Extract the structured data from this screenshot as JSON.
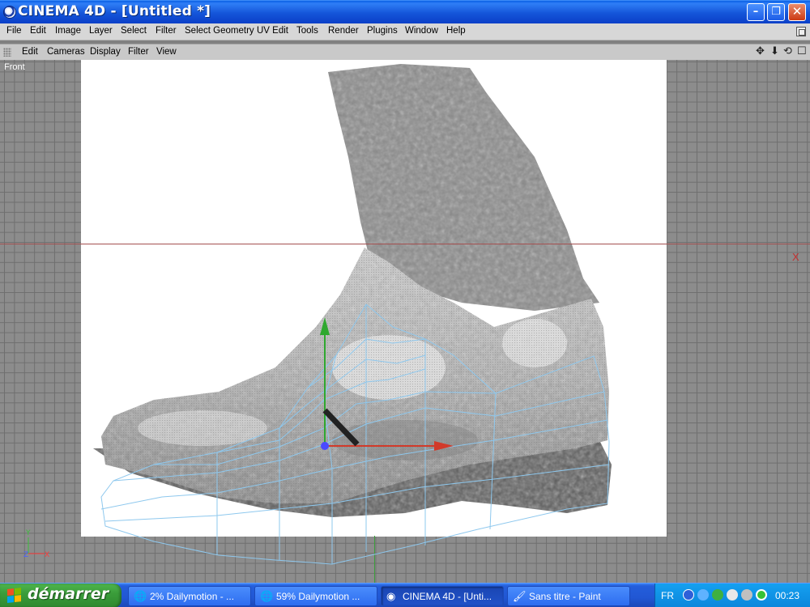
{
  "window": {
    "title": "CINEMA 4D - [Untitled *]",
    "min_glyph": "–",
    "max_glyph": "❐",
    "close_glyph": "✕"
  },
  "menubar": {
    "items": [
      "File",
      "Edit",
      "Image",
      "Layer",
      "Select",
      "Filter",
      "Select Geometry",
      "UV Edit",
      "Tools",
      "Render",
      "Plugins",
      "Window",
      "Help"
    ]
  },
  "viewport_menu": {
    "items": [
      "Edit",
      "Cameras",
      "Display",
      "Filter",
      "View"
    ],
    "nav_icons": [
      "move-icon",
      "down-arrow-icon",
      "rotate-icon",
      "maximize-icon"
    ]
  },
  "viewport": {
    "view_name": "Front",
    "axis_x_label": "X",
    "corner_axis": {
      "y": "Y",
      "z": "Z",
      "x": "X"
    }
  },
  "taskbar": {
    "start_label": "démarrer",
    "tasks": [
      {
        "label": "2% Dailymotion - ...",
        "icon": "firefox-icon",
        "active": false
      },
      {
        "label": "59% Dailymotion ...",
        "icon": "firefox-icon",
        "active": false
      },
      {
        "label": "CINEMA 4D - [Unti...",
        "icon": "cinema4d-icon",
        "active": true
      },
      {
        "label": "Sans titre - Paint",
        "icon": "paint-icon",
        "active": false
      }
    ],
    "language": "FR",
    "clock": "00:23"
  },
  "colors": {
    "axis_x": "#d23a2a",
    "axis_y": "#2fa82f",
    "axis_z": "#4a4aff",
    "mesh_lines": "#8ec8ee",
    "titlebar_blue": "#0b3fc8",
    "start_green": "#3a9d3a"
  }
}
